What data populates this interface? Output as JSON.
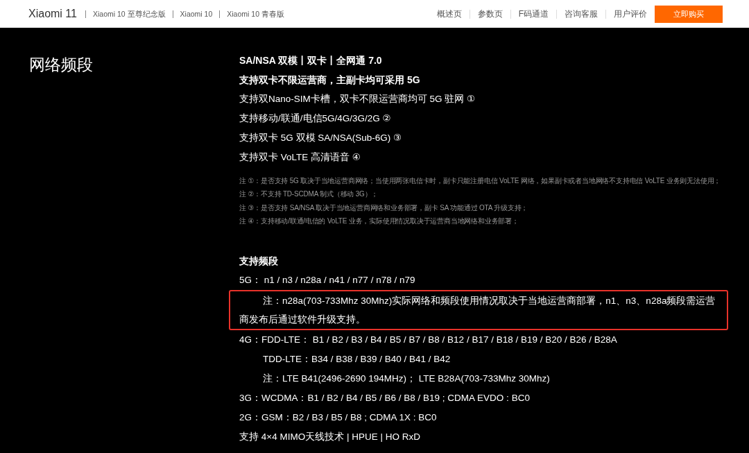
{
  "header": {
    "product": "Xiaomi 11",
    "models": [
      "Xiaomi 10 至尊纪念版",
      "Xiaomi 10",
      "Xiaomi 10 青春版"
    ],
    "nav": [
      "概述页",
      "参数页",
      "F码通道",
      "咨询客服",
      "用户评价"
    ],
    "buy_button": "立即购买"
  },
  "section": {
    "title": "网络频段",
    "features": [
      {
        "text": "SA/NSA 双模丨双卡丨全网通 7.0",
        "bold": true
      },
      {
        "text": "支持双卡不限运营商，主副卡均可采用 5G",
        "bold": true
      },
      {
        "text": "支持双Nano-SIM卡槽，双卡不限运营商均可 5G 驻网 ①",
        "bold": false
      },
      {
        "text": "支持移动/联通/电信5G/4G/3G/2G ②",
        "bold": false
      },
      {
        "text": "支持双卡 5G 双模 SA/NSA(Sub-6G) ③",
        "bold": false
      },
      {
        "text": "支持双卡 VoLTE 高清语音 ④",
        "bold": false
      }
    ],
    "notes": [
      "注 ①：是否支持 5G 取决于当地运营商网络；当使用两张电信卡时，副卡只能注册电信 VoLTE 网络，如果副卡或者当地网络不支持电信 VoLTE 业务则无法使用；",
      "注 ②：不支持 TD-SCDMA 制式（移动 3G）；",
      "注 ③：是否支持 SA/NSA 取决于当地运营商网络和业务部署，副卡 SA 功能通过 OTA 升级支持；",
      "注 ④：支持移动/联通/电信的 VoLTE 业务，实际使用情况取决于运营商当地网络和业务部署；"
    ],
    "bands": {
      "heading": "支持频段",
      "lines": [
        {
          "kind": "line",
          "text": "5G： n1 / n3 / n28a / n41 / n77 / n78 / n79"
        },
        {
          "kind": "highlight",
          "text": "注：n28a(703-733Mhz 30Mhz)实际网络和频段使用情况取决于当地运营商部署，n1、n3、n28a频段需运营商发布后通过软件升级支持。"
        },
        {
          "kind": "line",
          "text": "4G：FDD-LTE： B1 / B2 / B3 / B4 / B5 / B7 / B8 / B12 / B17 / B18 / B19 / B20 / B26 / B28A"
        },
        {
          "kind": "indent",
          "text": "TDD-LTE：B34 / B38 / B39 / B40 / B41 / B42"
        },
        {
          "kind": "indent",
          "text": "注：LTE B41(2496-2690 194MHz)； LTE B28A(703-733Mhz 30Mhz)"
        },
        {
          "kind": "line",
          "text": "3G：WCDMA：B1 / B2 / B4 / B5 / B6 / B8 / B19 ; CDMA EVDO : BC0"
        },
        {
          "kind": "line",
          "text": "2G：GSM：B2 / B3 / B5 / B8 ; CDMA 1X : BC0"
        },
        {
          "kind": "line",
          "text": "支持 4×4 MIMO天线技术 | HPUE | HO RxD"
        }
      ]
    }
  }
}
